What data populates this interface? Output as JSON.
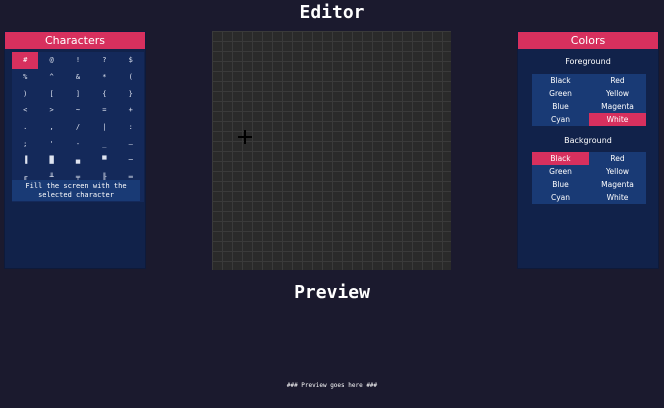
{
  "titles": {
    "editor": "Editor",
    "preview": "Preview"
  },
  "characters": {
    "header": "Characters",
    "grid": [
      [
        "#",
        "@",
        "!",
        "?",
        "$"
      ],
      [
        "%",
        "^",
        "&",
        "*",
        "("
      ],
      [
        ")",
        "[",
        "]",
        "{",
        "}"
      ],
      [
        "<",
        ">",
        "~",
        "=",
        "+"
      ],
      [
        ".",
        ",",
        "/",
        "|",
        ":"
      ],
      [
        ";",
        "'",
        "-",
        "_",
        "–"
      ],
      [
        "▐",
        "█",
        "▄",
        "▀",
        "─"
      ],
      [
        "╓",
        "╨",
        "╤",
        "╟",
        "═"
      ],
      [
        "╞",
        "╡",
        "╥",
        "╢",
        "╛"
      ]
    ],
    "selected": "#",
    "fill_button": "Fill the screen with the selected character"
  },
  "colors": {
    "header": "Colors",
    "foreground_label": "Foreground",
    "background_label": "Background",
    "foreground": [
      "Black",
      "Red",
      "Green",
      "Yellow",
      "Blue",
      "Magenta",
      "Cyan",
      "White"
    ],
    "background": [
      "Black",
      "Red",
      "Green",
      "Yellow",
      "Blue",
      "Magenta",
      "Cyan",
      "White"
    ],
    "foreground_selected": "White",
    "background_selected": "Black"
  },
  "preview": {
    "placeholder": "### Preview goes here ###"
  },
  "theme": {
    "accent": "#d7305e",
    "panel": "#11224a",
    "bg": "#1b1a2e"
  }
}
